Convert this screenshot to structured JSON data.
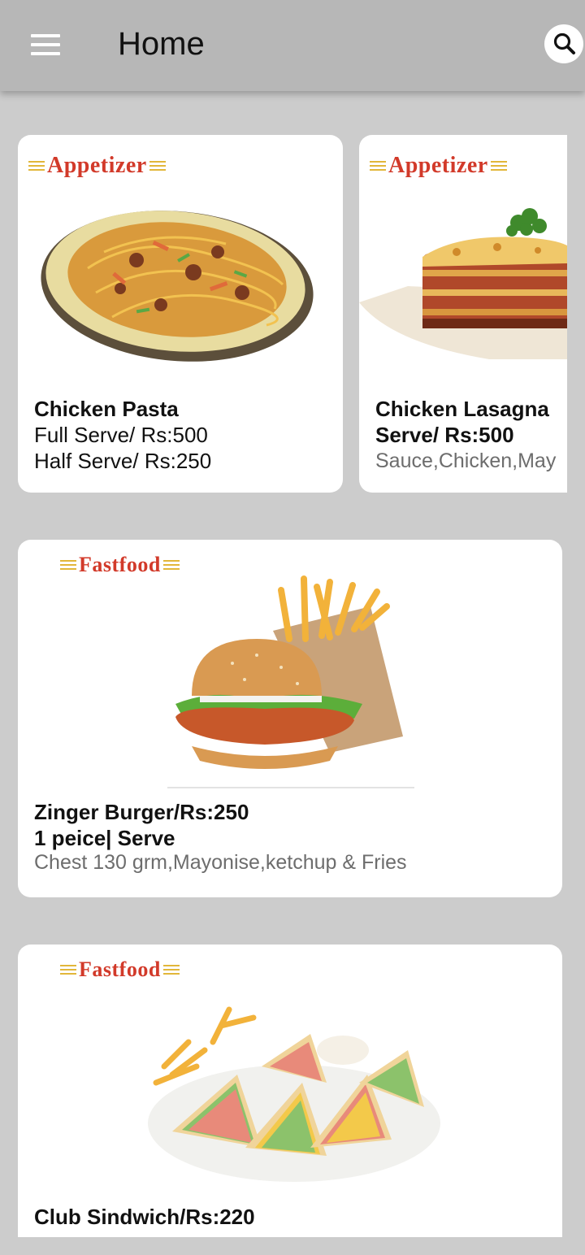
{
  "appbar": {
    "title": "Home",
    "menu_icon": "hamburger-menu-icon",
    "search_icon": "search-icon"
  },
  "colors": {
    "appbar": "#b7b7b7",
    "background": "#cccccc",
    "category_red": "#d23a2a",
    "category_gold": "#e2b73a"
  },
  "cards": [
    {
      "category": "Appetizer",
      "name": "Chicken Pasta",
      "line1": "Full Serve/ Rs:500",
      "line2": "Half Serve/ Rs:250",
      "image": "chicken-pasta-image"
    },
    {
      "category": "Appetizer",
      "name": "Chicken Lasagna",
      "line1": "Serve/ Rs:500",
      "line2": "Sauce,Chicken,May",
      "image": "chicken-lasagna-image"
    },
    {
      "category": "Fastfood",
      "name": "Zinger Burger/Rs:250",
      "line1": "1 peice| Serve",
      "line2": "Chest 130 grm,Mayonise,ketchup & Fries",
      "image": "zinger-burger-image"
    },
    {
      "category": "Fastfood",
      "name": "Club Sindwich/Rs:220",
      "image": "club-sandwich-image"
    }
  ]
}
